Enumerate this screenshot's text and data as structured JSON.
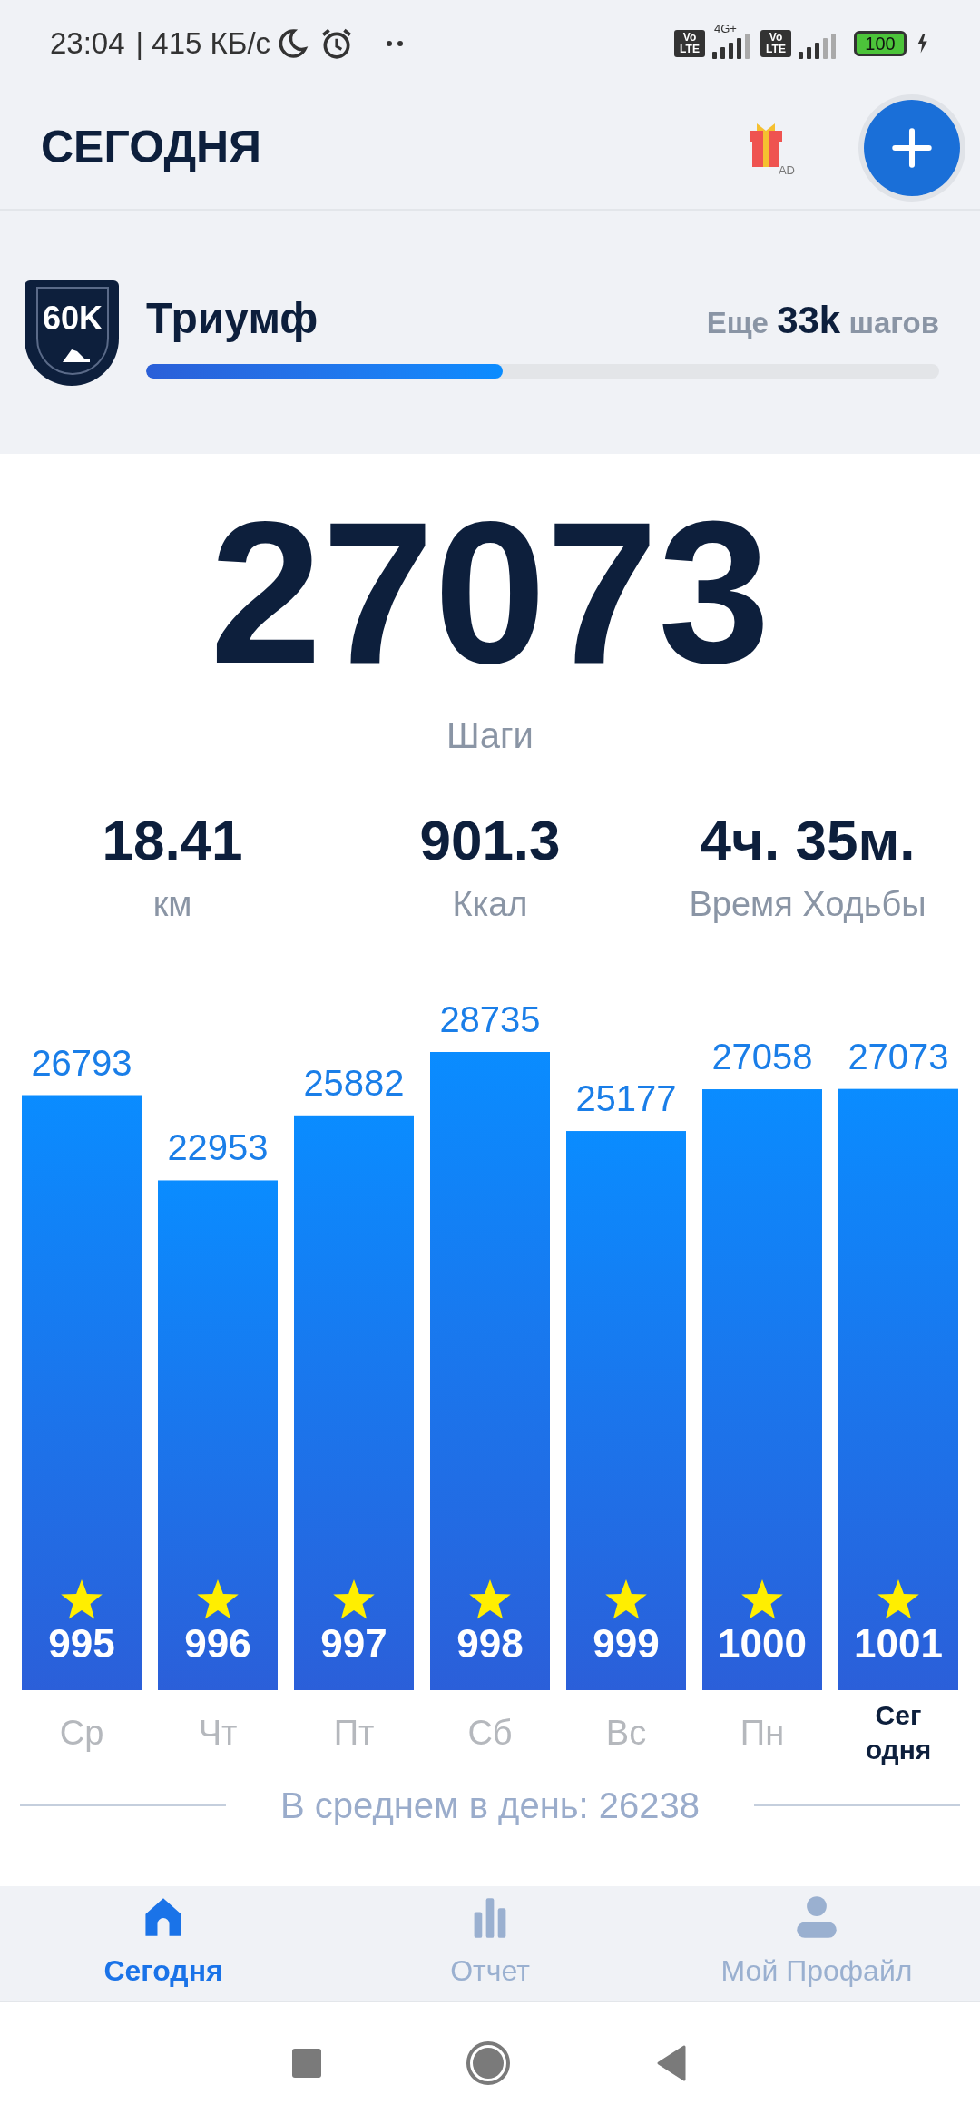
{
  "status_bar": {
    "time": "23:04",
    "speed": "| 415 КБ/с",
    "sims": [
      {
        "volte": [
          "Vo",
          "LTE"
        ],
        "network": "4G+"
      },
      {
        "volte": [
          "Vo",
          "LTE"
        ]
      }
    ],
    "battery": "100"
  },
  "header": {
    "title": "СЕГОДНЯ",
    "gift_tag": "AD"
  },
  "goal": {
    "badge": "60K",
    "title": "Триумф",
    "remaining": "Еще **33k** шагов",
    "level": 0.45
  },
  "steps": {
    "value": "27073",
    "label": "Шаги"
  },
  "stats": [
    {
      "value": "18.41",
      "label": "км"
    },
    {
      "value": "901.3",
      "label": "Ккал"
    },
    {
      "value": "4ч. 35м.",
      "label": "Время Ходьбы"
    }
  ],
  "chart": {
    "chart_data": {
      "type": "bar",
      "categories": [
        "Ср",
        "Чт",
        "Пт",
        "Сб",
        "Вс",
        "Пн",
        "Сег одня"
      ],
      "series": [
        {
          "color": "#0a8cff",
          "values": [
            26793,
            22953,
            25882,
            28735,
            25177,
            27058,
            27073
          ]
        }
      ],
      "data_labels": true
    },
    "days": [
      {
        "count": "995",
        "selected": false
      },
      {
        "count": "996",
        "selected": false
      },
      {
        "count": "997",
        "selected": false
      },
      {
        "count": "998",
        "selected": false
      },
      {
        "count": "999",
        "selected": false
      },
      {
        "count": "1000",
        "selected": false
      },
      {
        "count": "1001",
        "selected": true
      }
    ]
  },
  "average": "В среднем в день: 26238",
  "bottom_nav": [
    {
      "label": "Сегодня",
      "kind": "home",
      "selected": true
    },
    {
      "label": "Отчет",
      "kind": "report",
      "selected": false
    },
    {
      "label": "Мой Профайл",
      "kind": "profile",
      "selected": false
    }
  ]
}
